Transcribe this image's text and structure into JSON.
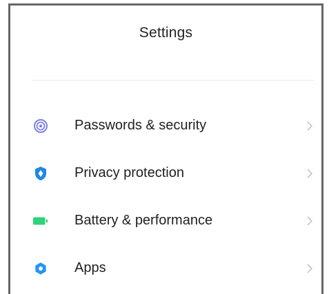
{
  "header": {
    "title": "Settings"
  },
  "items": [
    {
      "label": "Passwords & security",
      "icon": "fingerprint-icon",
      "color": "#7b7fe6"
    },
    {
      "label": "Privacy protection",
      "icon": "privacy-shield-icon",
      "color": "#1e88e5"
    },
    {
      "label": "Battery & performance",
      "icon": "battery-icon",
      "color": "#2bd47a"
    },
    {
      "label": "Apps",
      "icon": "gear-icon",
      "color": "#2196f3"
    }
  ],
  "colors": {
    "text": "#1f1f1f",
    "chevron": "#bdbdbd",
    "divider": "#ececec",
    "frame": "#666666"
  }
}
